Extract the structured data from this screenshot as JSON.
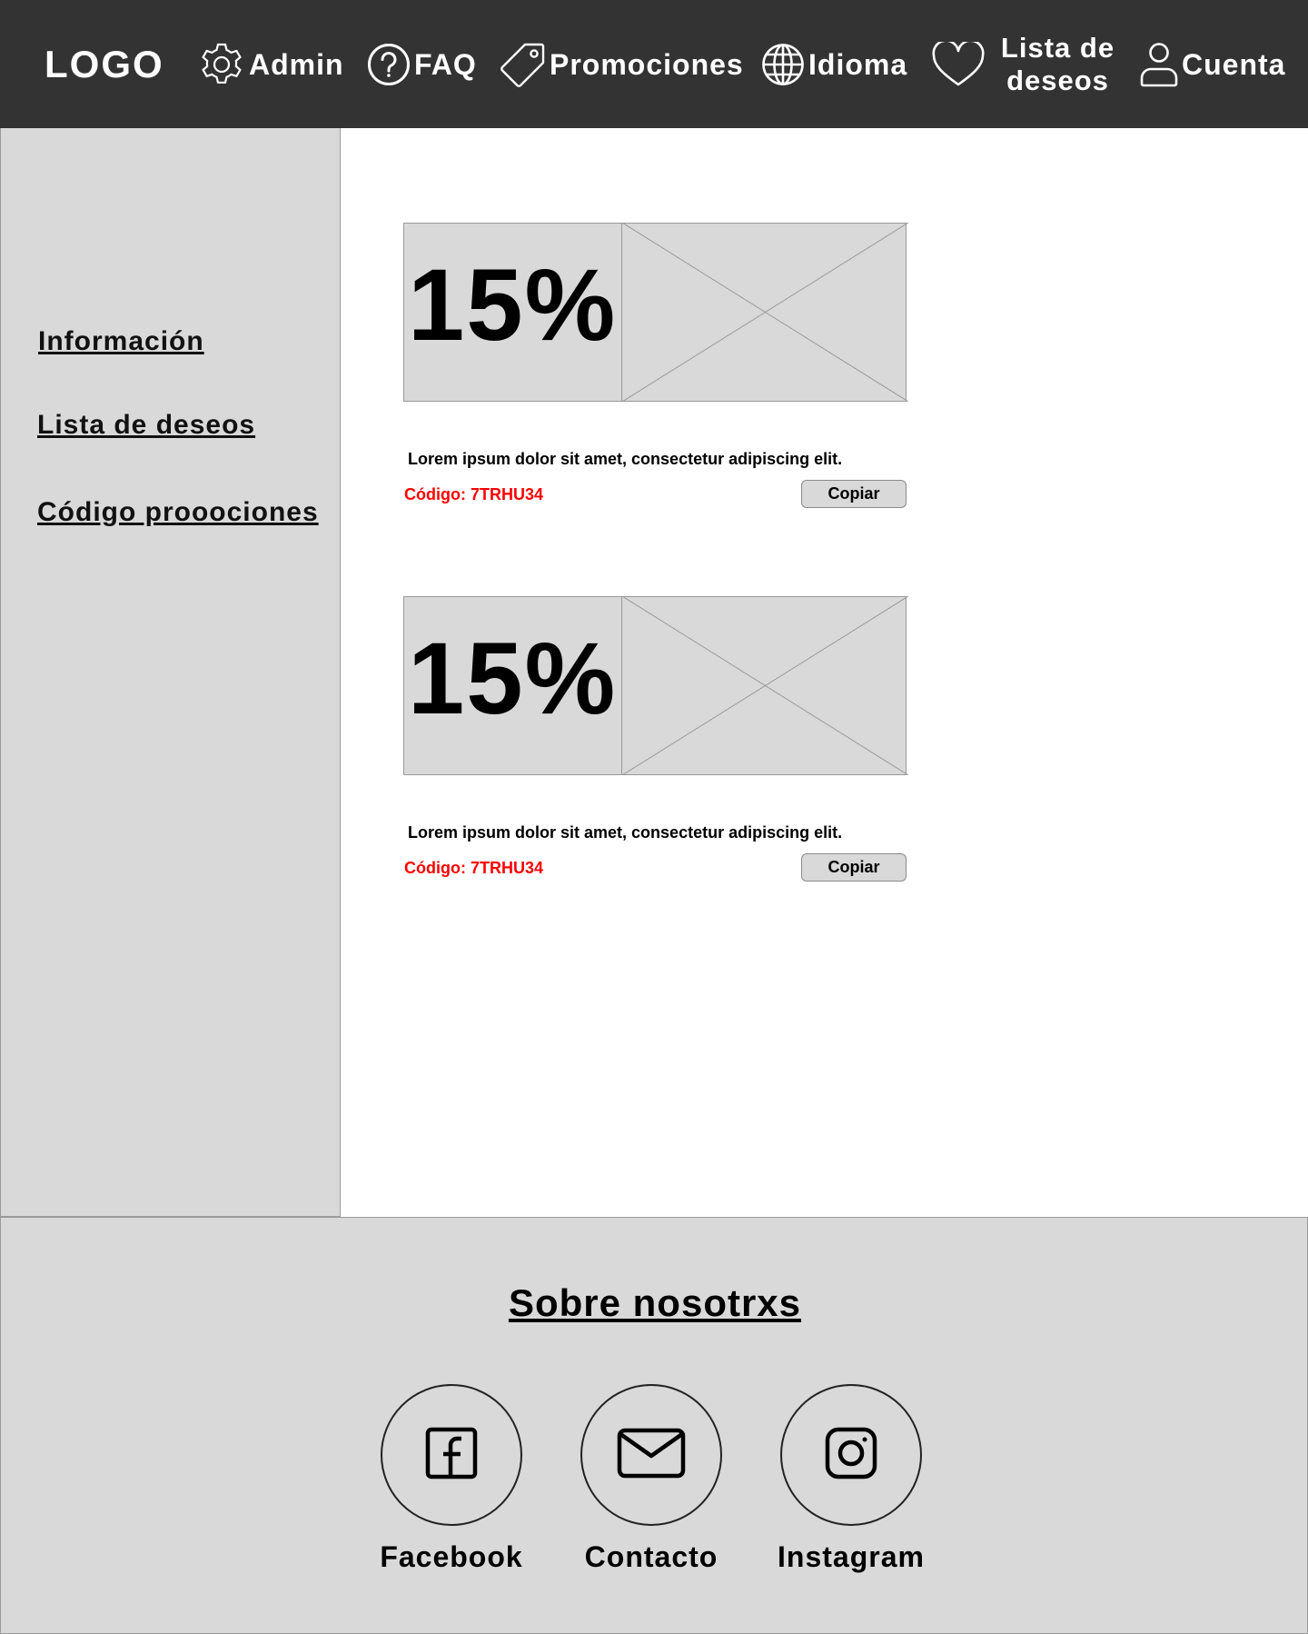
{
  "header": {
    "logo": "LOGO",
    "nav": {
      "admin": "Admin",
      "faq": "FAQ",
      "promociones": "Promociones",
      "idioma": "Idioma",
      "wishlist_line1": "Lista de",
      "wishlist_line2": "deseos",
      "cuenta": "Cuenta"
    },
    "icons": [
      "gear-icon",
      "question-circle-icon",
      "tag-icon",
      "globe-icon",
      "heart-icon",
      "user-icon"
    ]
  },
  "sidebar": {
    "items": [
      {
        "label": "Información"
      },
      {
        "label": "Lista de deseos"
      },
      {
        "label": "Código prooociones"
      }
    ]
  },
  "promos": [
    {
      "percent": "15%",
      "description": "Lorem ipsum dolor sit amet, consectetur adipiscing elit.",
      "code": "Código: 7TRHU34",
      "button": "Copiar"
    },
    {
      "percent": "15%",
      "description": "Lorem ipsum dolor sit amet, consectetur adipiscing elit.",
      "code": "Código: 7TRHU34",
      "button": "Copiar"
    }
  ],
  "footer": {
    "title": "Sobre nosotrxs",
    "social": [
      {
        "label": "Facebook",
        "icon": "facebook-icon"
      },
      {
        "label": "Contacto",
        "icon": "mail-icon"
      },
      {
        "label": "Instagram",
        "icon": "instagram-icon"
      }
    ]
  },
  "colors": {
    "header_bg": "#333333",
    "panel_bg": "#d9d9d9",
    "code_text": "#ff0000"
  }
}
